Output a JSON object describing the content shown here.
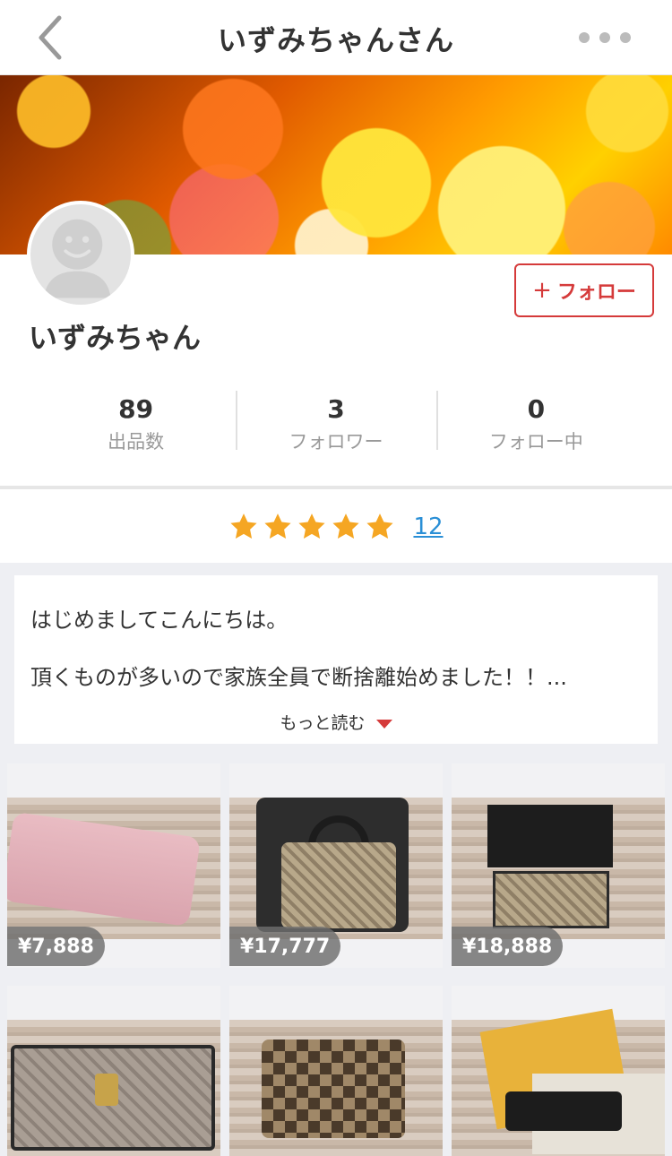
{
  "header": {
    "title": "いずみちゃんさん",
    "back_icon": "chevron-left-icon",
    "more_icon": "more-horizontal-icon"
  },
  "profile": {
    "name": "いずみちゃん",
    "follow_label": "フォロー",
    "follow_plus": "+"
  },
  "stats": [
    {
      "value": "89",
      "label": "出品数"
    },
    {
      "value": "3",
      "label": "フォロワー"
    },
    {
      "value": "0",
      "label": "フォロー中"
    }
  ],
  "rating": {
    "stars": 5,
    "max_stars": 5,
    "count": "12",
    "star_color": "#f5a623"
  },
  "intro": {
    "line1": "はじめましてこんにちは。",
    "line2": "頂くものが多いので家族全員で断捨離始めました！！...",
    "more_label": "もっと読む"
  },
  "items": [
    {
      "price": "¥7,888"
    },
    {
      "price": "¥17,777"
    },
    {
      "price": "¥18,888"
    },
    {
      "price": ""
    },
    {
      "price": ""
    },
    {
      "price": ""
    }
  ],
  "colors": {
    "accent_red": "#d53a3a",
    "link_blue": "#2a8fd6"
  }
}
